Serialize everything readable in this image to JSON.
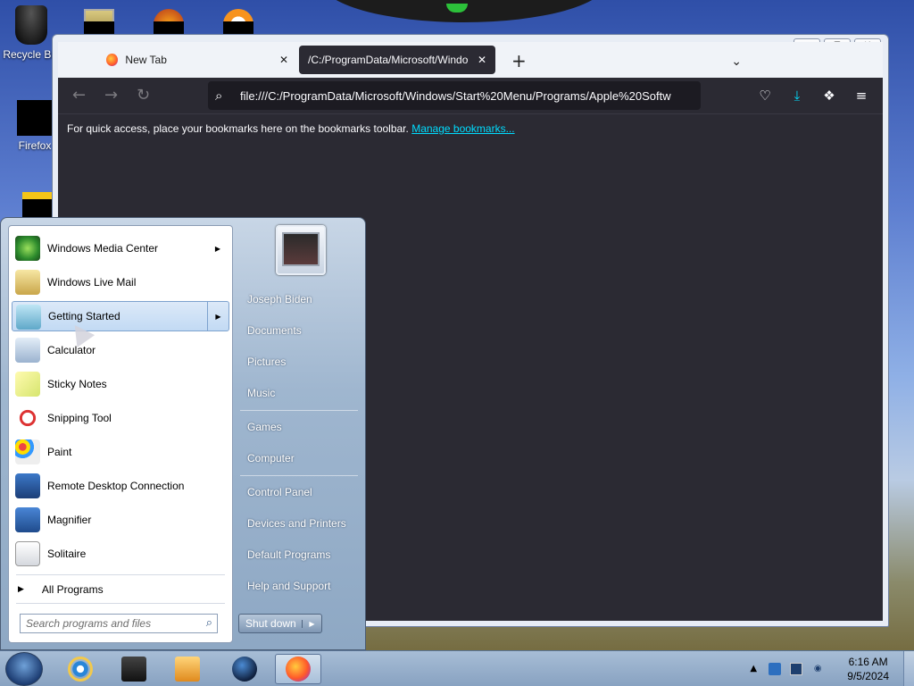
{
  "desktop": {
    "icons": [
      {
        "label": "Recycle Bin"
      },
      {
        "label": "Firefox"
      }
    ]
  },
  "browser": {
    "window_buttons": {
      "minimize": "▭",
      "maximize": "▢",
      "close": "✕"
    },
    "tabs": [
      {
        "label": "New Tab",
        "close": "✕",
        "active": false
      },
      {
        "label": "/C:/ProgramData/Microsoft/Windo",
        "close": "✕",
        "active": true
      }
    ],
    "new_tab": "+",
    "tab_list": "⌄",
    "nav": {
      "back": "←",
      "forward": "→",
      "reload": "↻"
    },
    "url": "file:///C:/ProgramData/Microsoft/Windows/Start%20Menu/Programs/Apple%20Softw",
    "bookmarks_bar": {
      "text": "For quick access, place your bookmarks here on the bookmarks toolbar.",
      "link": "Manage bookmarks..."
    },
    "colors": {
      "toolbar": "#2b2a33",
      "link": "#00ddff",
      "download": "#00ddff"
    }
  },
  "start_menu": {
    "programs": [
      {
        "label": "Windows Media Center",
        "icon": "media-center-icon",
        "has_submenu": true
      },
      {
        "label": "Windows Live Mail",
        "icon": "live-mail-icon",
        "has_submenu": false
      },
      {
        "label": "Getting Started",
        "icon": "getting-started-icon",
        "has_submenu": true,
        "selected": true
      },
      {
        "label": "Calculator",
        "icon": "calculator-icon",
        "has_submenu": false
      },
      {
        "label": "Sticky Notes",
        "icon": "sticky-notes-icon",
        "has_submenu": false
      },
      {
        "label": "Snipping Tool",
        "icon": "snipping-tool-icon",
        "has_submenu": false
      },
      {
        "label": "Paint",
        "icon": "paint-icon",
        "has_submenu": false
      },
      {
        "label": "Remote Desktop Connection",
        "icon": "remote-desktop-icon",
        "has_submenu": false
      },
      {
        "label": "Magnifier",
        "icon": "magnifier-icon",
        "has_submenu": false
      },
      {
        "label": "Solitaire",
        "icon": "solitaire-icon",
        "has_submenu": false
      }
    ],
    "all_programs": "All Programs",
    "search_placeholder": "Search programs and files",
    "right_links": [
      "Joseph Biden",
      "Documents",
      "Pictures",
      "Music",
      "Games",
      "Computer",
      "Control Panel",
      "Devices and Printers",
      "Default Programs",
      "Help and Support"
    ],
    "shutdown": "Shut down",
    "arrow": "▶"
  },
  "taskbar": {
    "apps": [
      "start-orb",
      "internet-explorer",
      "media-device",
      "media-player",
      "globe-app",
      "firefox"
    ],
    "tray": {
      "show_hidden": "▲",
      "time": "6:16 AM",
      "date": "9/5/2024"
    }
  }
}
